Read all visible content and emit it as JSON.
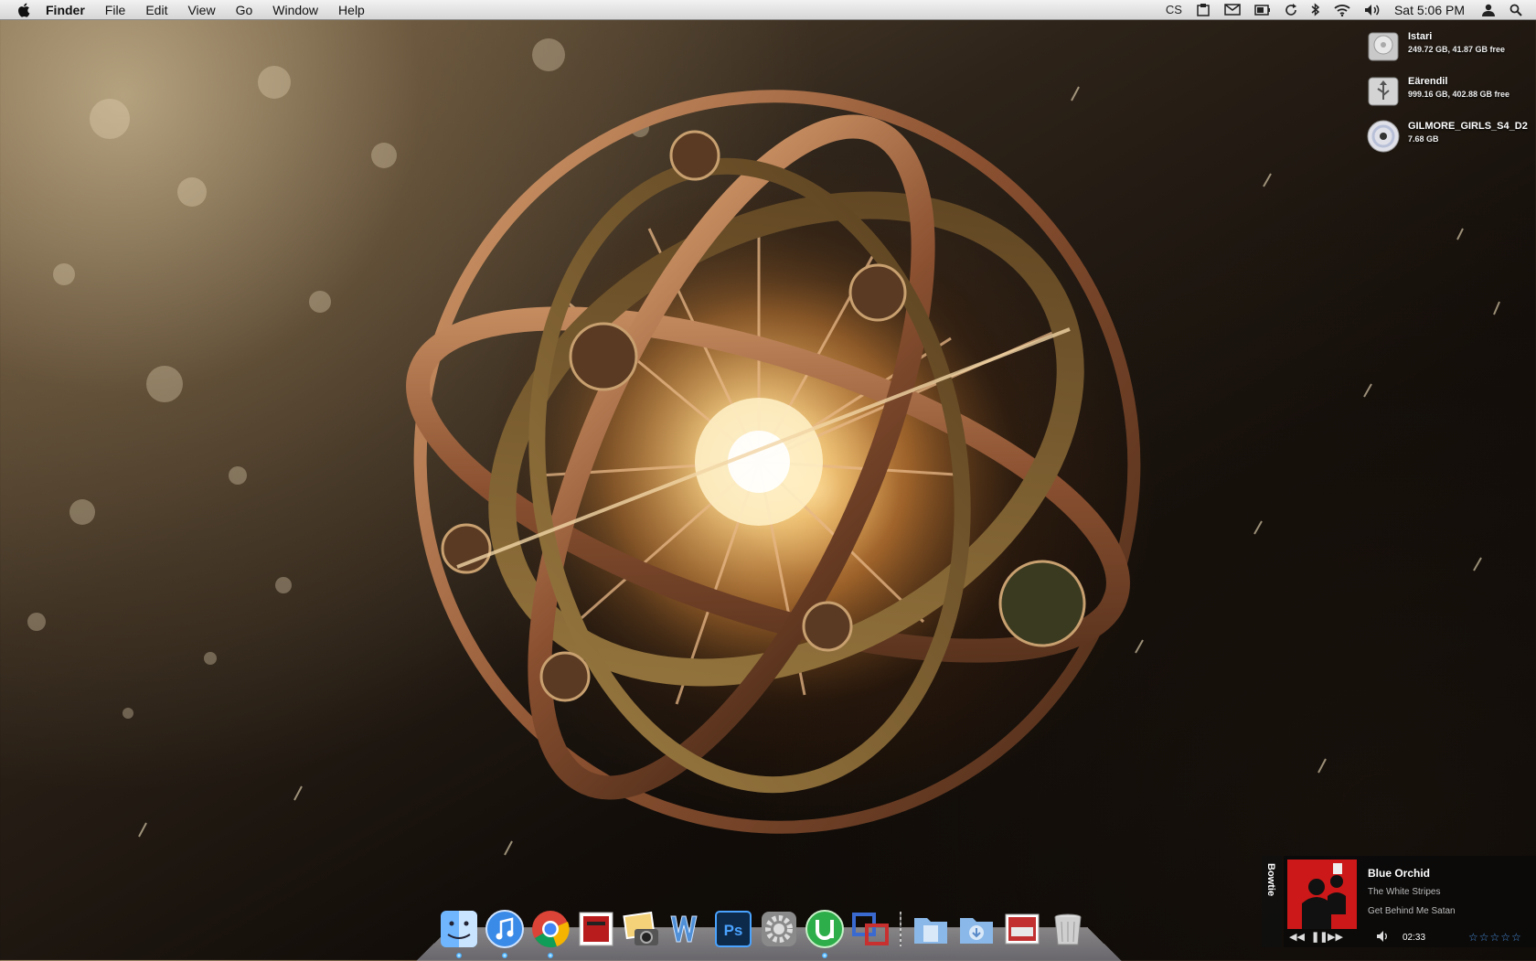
{
  "menubar": {
    "app": "Finder",
    "menus": [
      "File",
      "Edit",
      "View",
      "Go",
      "Window",
      "Help"
    ],
    "extras_icons": [
      "cs-status-icon",
      "clipboard-icon",
      "mail-icon",
      "battery-icon",
      "sync-icon",
      "bluetooth-icon",
      "wifi-icon",
      "volume-icon"
    ],
    "cs_label": "CS",
    "clock": "Sat 5:06 PM"
  },
  "desktop": {
    "volumes": [
      {
        "name": "Istari",
        "info": "249.72 GB, 41.87 GB free",
        "icon": "hard-drive-icon"
      },
      {
        "name": "Eärendil",
        "info": "999.16 GB, 402.88 GB free",
        "icon": "usb-drive-icon"
      },
      {
        "name": "GILMORE_GIRLS_S4_D2",
        "info": "7.68 GB",
        "icon": "dvd-icon"
      }
    ]
  },
  "dock": {
    "apps": [
      "Finder",
      "iTunes",
      "Google Chrome",
      "Mail Stamp",
      "iPhoto",
      "Word",
      "Photoshop",
      "System Preferences",
      "uTorrent",
      "Coda"
    ],
    "stacks": [
      "Documents",
      "Downloads",
      "Pictures",
      "Trash"
    ]
  },
  "bowtie": {
    "label": "Bowtie",
    "song": "Blue Orchid",
    "artist": "The White Stripes",
    "album": "Get Behind Me Satan",
    "time": "02:33",
    "rating": "☆☆☆☆☆",
    "accent": "#4a90e0"
  },
  "colors": {
    "menubar_bg": "#e4e4e4",
    "dock_indicator": "#44aaff"
  }
}
